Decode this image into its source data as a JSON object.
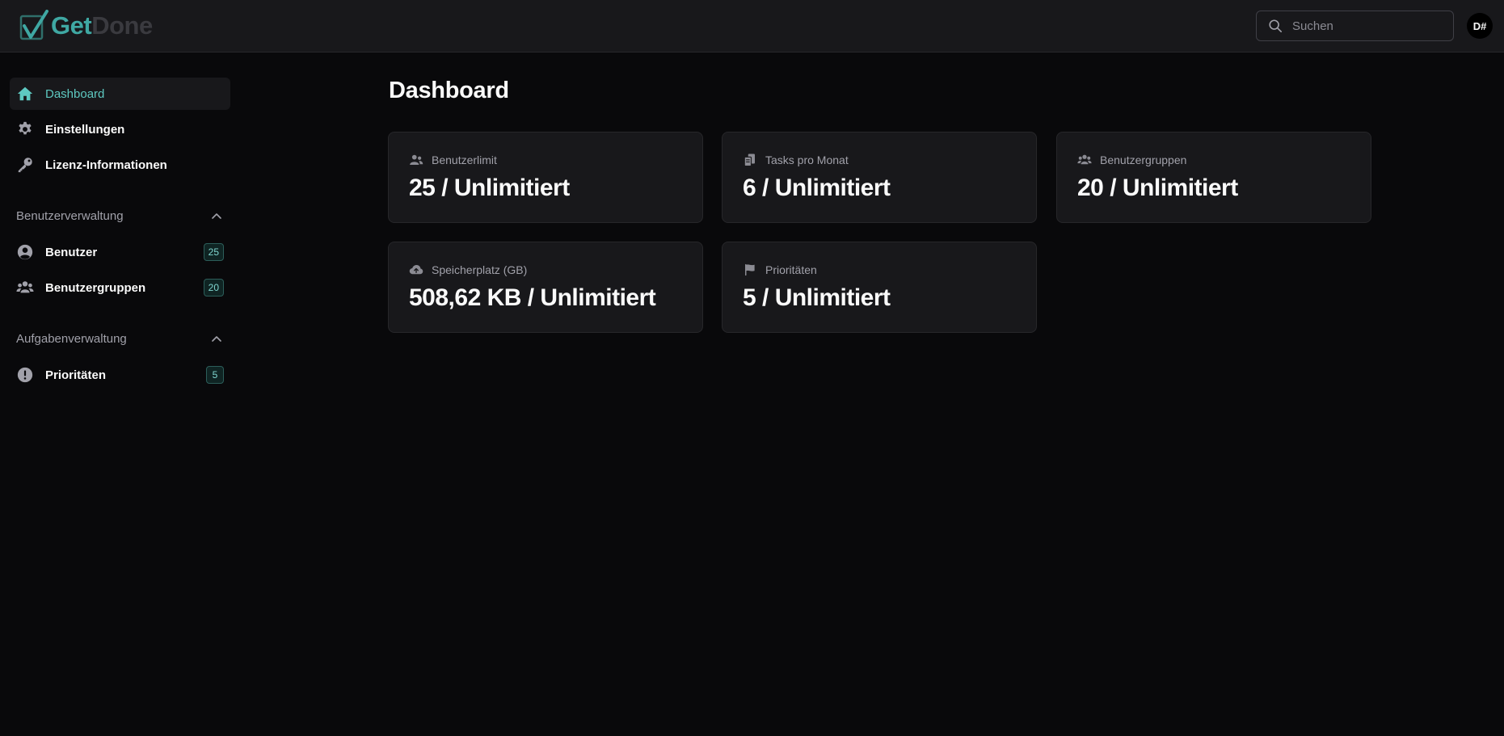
{
  "app": {
    "logo_get": "Get",
    "logo_done": "Done",
    "brand_color": "#3fa8a3"
  },
  "header": {
    "search_placeholder": "Suchen",
    "avatar_initials": "D#"
  },
  "sidebar": {
    "items": [
      {
        "label": "Dashboard",
        "icon": "home-icon",
        "active": true
      },
      {
        "label": "Einstellungen",
        "icon": "gear-icon"
      },
      {
        "label": "Lizenz-Informationen",
        "icon": "key-icon"
      }
    ],
    "sections": [
      {
        "title": "Benutzerverwaltung",
        "items": [
          {
            "label": "Benutzer",
            "icon": "user-circle-icon",
            "count": "25"
          },
          {
            "label": "Benutzergruppen",
            "icon": "users-group-icon",
            "count": "20"
          }
        ]
      },
      {
        "title": "Aufgabenverwaltung",
        "items": [
          {
            "label": "Prioritäten",
            "icon": "exclamation-circle-icon",
            "count": "5"
          }
        ]
      }
    ]
  },
  "main": {
    "title": "Dashboard",
    "cards": [
      {
        "label": "Benutzerlimit",
        "value": "25 / Unlimitiert",
        "icon": "users-icon"
      },
      {
        "label": "Tasks pro Monat",
        "value": "6 / Unlimitiert",
        "icon": "documents-icon"
      },
      {
        "label": "Benutzergruppen",
        "value": "20 / Unlimitiert",
        "icon": "users-group-icon"
      },
      {
        "label": "Speicherplatz (GB)",
        "value": "508,62 KB / Unlimitiert",
        "icon": "cloud-upload-icon"
      },
      {
        "label": "Prioritäten",
        "value": "5 / Unlimitiert",
        "icon": "flag-icon"
      }
    ]
  }
}
